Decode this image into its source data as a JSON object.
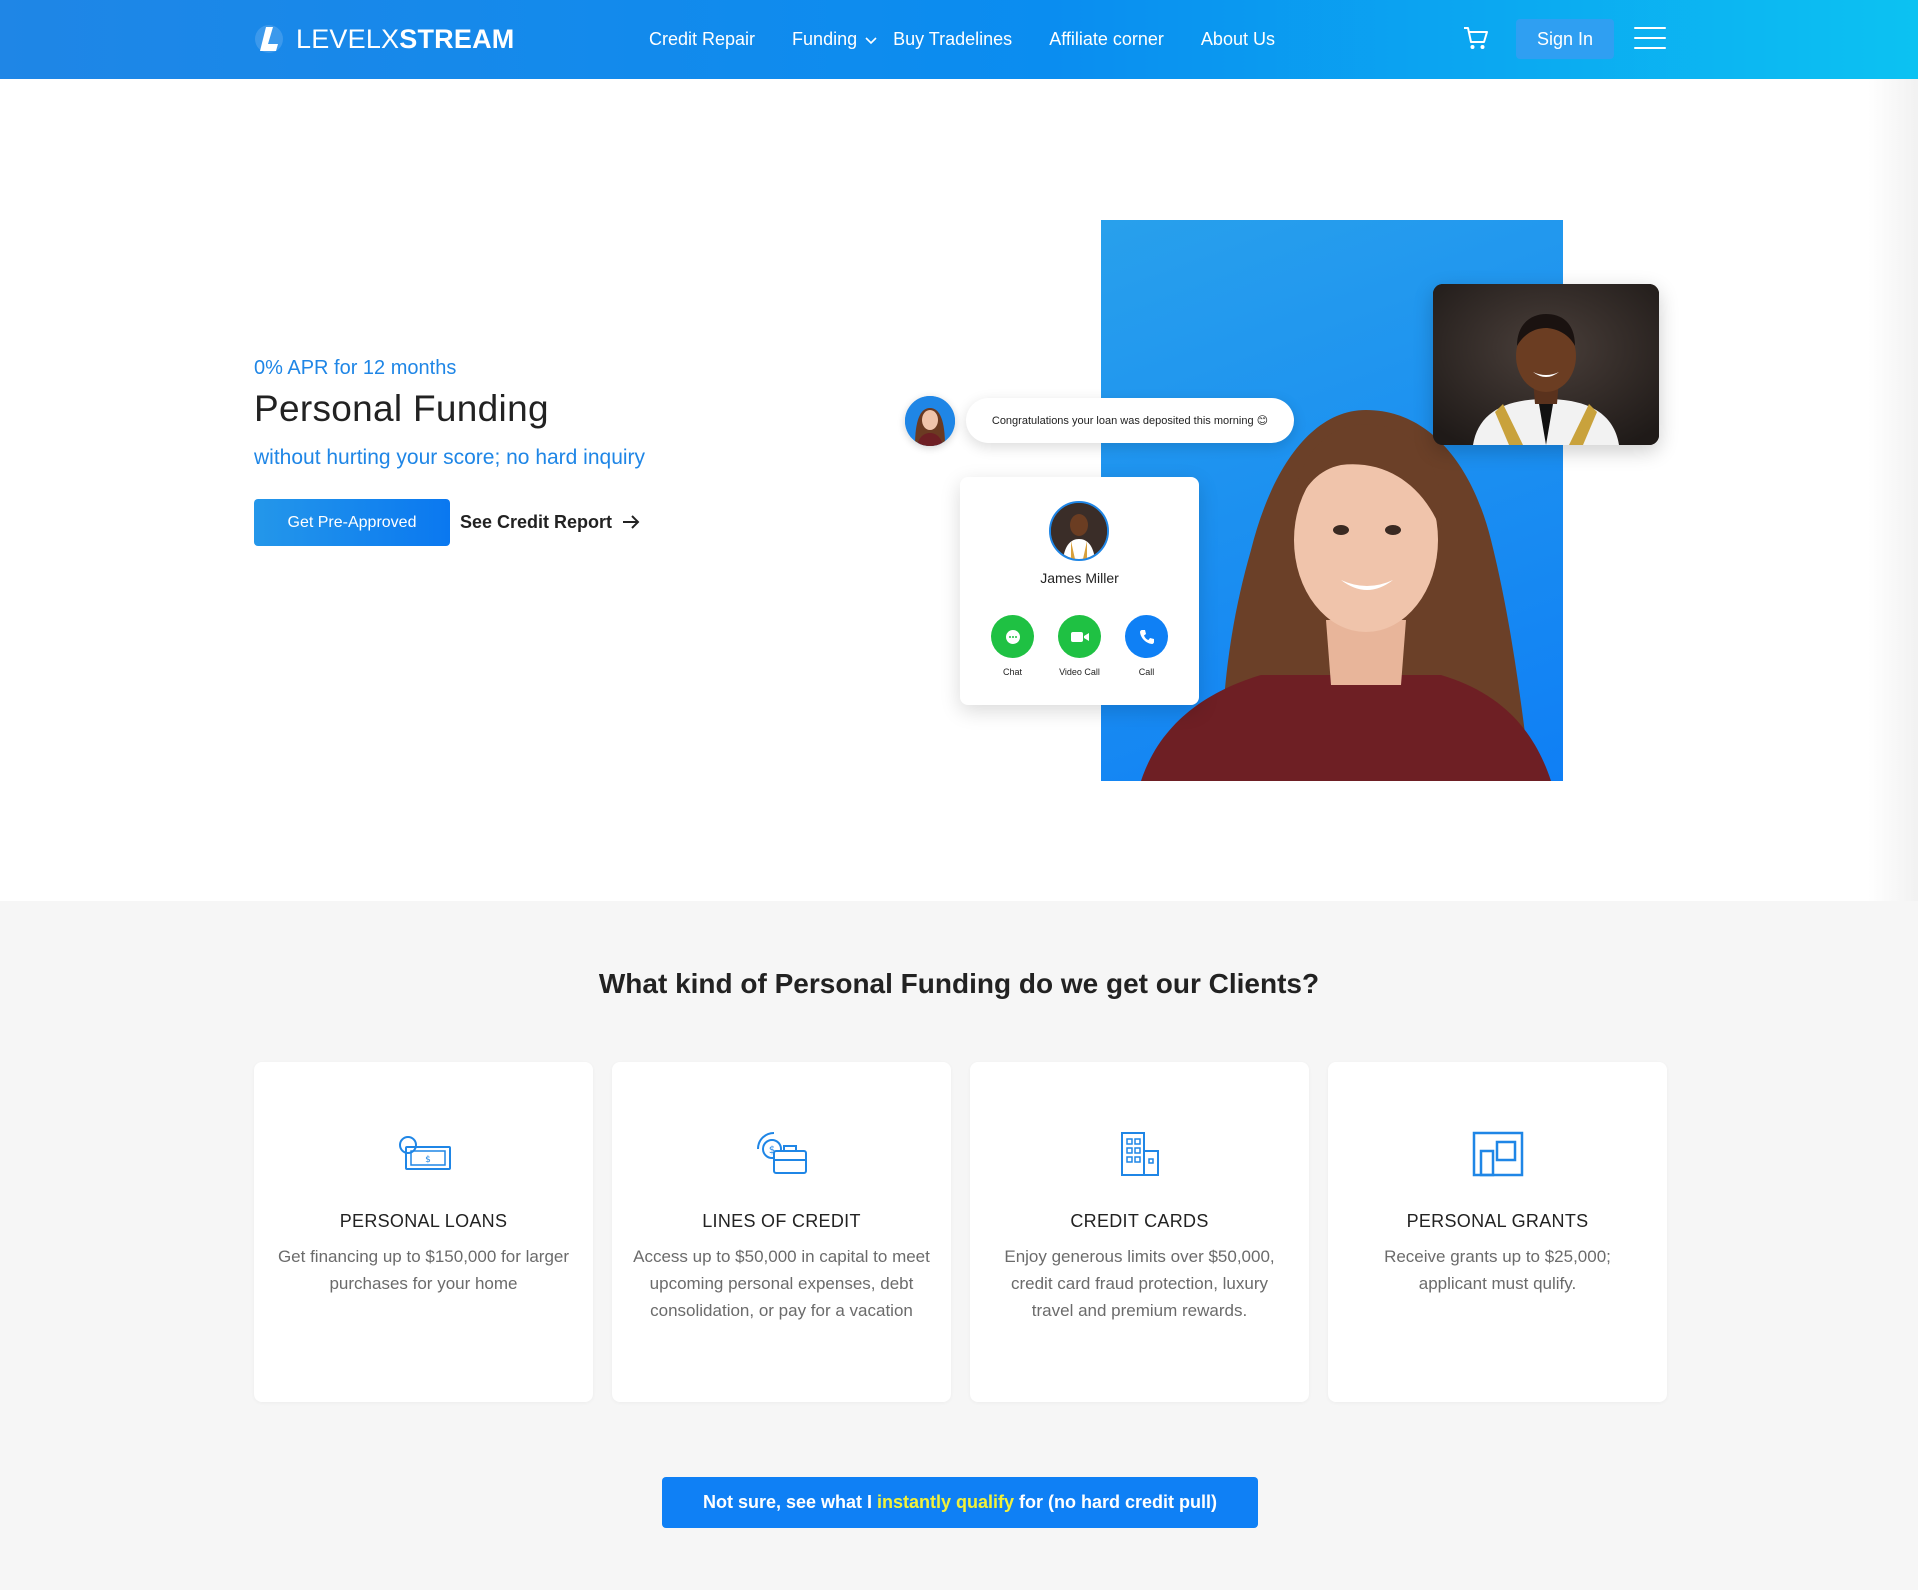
{
  "header": {
    "logo": {
      "part1": "LEVELX",
      "part2": "STREAM"
    },
    "nav": [
      {
        "label": "Credit Repair"
      },
      {
        "label": "Funding"
      },
      {
        "label": "Buy Tradelines"
      },
      {
        "label": "Affiliate corner"
      },
      {
        "label": "About Us"
      }
    ],
    "signin_label": "Sign In",
    "icons": {
      "cart": "cart-icon",
      "menu": "hamburger-icon",
      "dropdown": "chevron-down-icon"
    }
  },
  "hero": {
    "eyebrow": "0% APR for 12 months",
    "title": "Personal Funding",
    "subtitle": "without hurting your score; no hard inquiry",
    "primary_button": "Get Pre-Approved",
    "secondary_button": "See Credit Report",
    "chat_message": "Congratulations your loan was deposited this morning 😊",
    "caller": {
      "name": "James Miller",
      "actions": [
        {
          "label": "Chat",
          "icon": "chat-icon"
        },
        {
          "label": "Video Call",
          "icon": "video-icon"
        },
        {
          "label": "Call",
          "icon": "phone-icon"
        }
      ]
    }
  },
  "features": {
    "title": "What kind of Personal Funding do we get our Clients?",
    "cards": [
      {
        "title": "PERSONAL LOANS",
        "text": "Get financing up to $150,000 for larger purchases for your home",
        "icon": "money-icon"
      },
      {
        "title": "LINES OF CREDIT",
        "text": "Access up to $50,000 in capital to meet upcoming personal expenses, debt consolidation, or pay for a vacation",
        "icon": "briefcase-dollar-icon"
      },
      {
        "title": "CREDIT CARDS",
        "text": "Enjoy generous limits over $50,000, credit card fraud protection, luxury travel and premium rewards.",
        "icon": "building-icon"
      },
      {
        "title": "PERSONAL GRANTS",
        "text": "Receive grants up to $25,000; applicant must qulify.",
        "icon": "frame-icon"
      }
    ],
    "cta": {
      "before": "Not sure, see what I",
      "highlight": "instantly qualify",
      "after": "for (no hard credit pull)"
    }
  },
  "colors": {
    "brand": "#1f86e6",
    "accent": "#0f80f5",
    "highlight": "#f3f13a",
    "green": "#1fc143"
  }
}
